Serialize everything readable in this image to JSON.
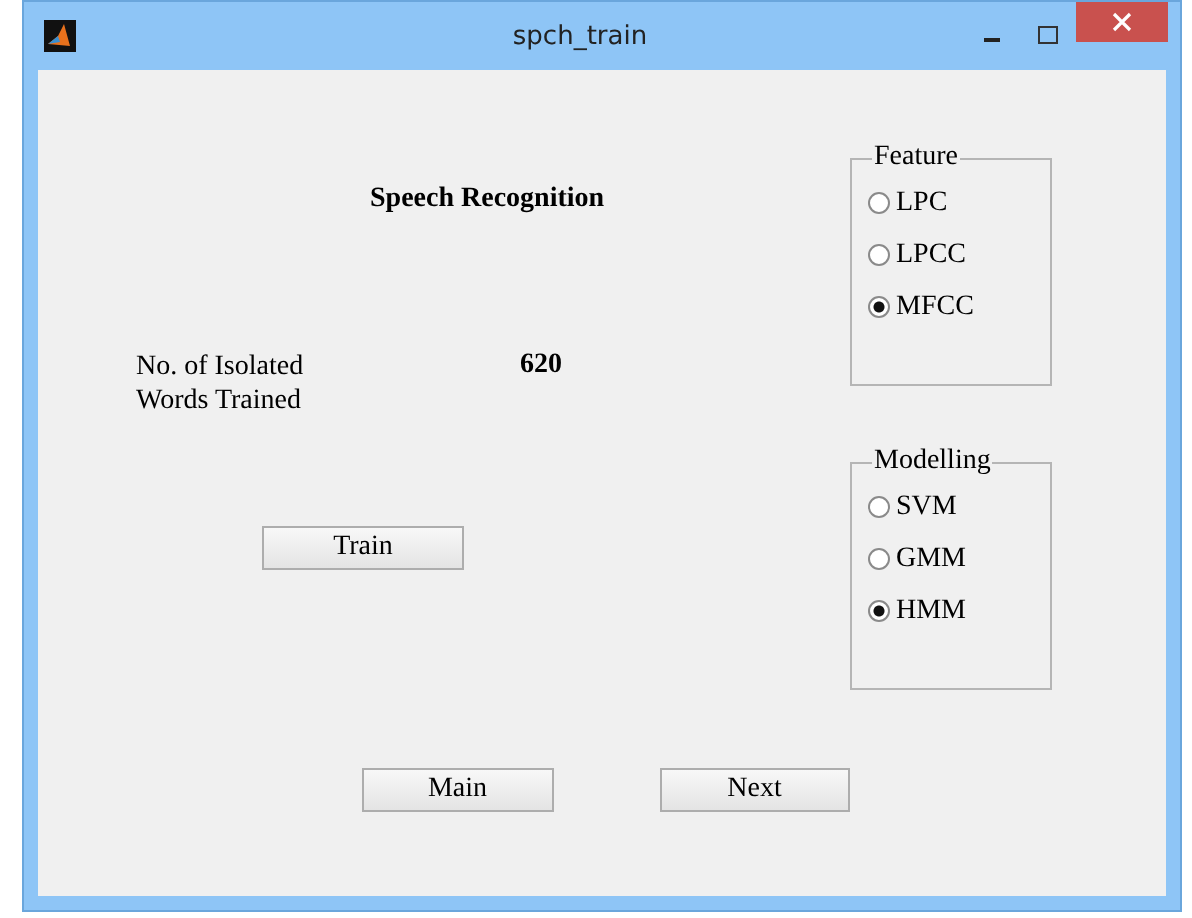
{
  "window": {
    "title": "spch_train"
  },
  "heading": "Speech Recognition",
  "count_label": "No. of Isolated Words Trained",
  "count_value": "620",
  "train_button": "Train",
  "groups": [
    {
      "title": "Feature",
      "options": [
        {
          "label": "LPC",
          "selected": false
        },
        {
          "label": "LPCC",
          "selected": false
        },
        {
          "label": "MFCC",
          "selected": true
        }
      ]
    },
    {
      "title": "Modelling",
      "options": [
        {
          "label": "SVM",
          "selected": false
        },
        {
          "label": "GMM",
          "selected": false
        },
        {
          "label": "HMM",
          "selected": true
        }
      ]
    }
  ],
  "buttons": [
    "Main",
    "Next"
  ]
}
